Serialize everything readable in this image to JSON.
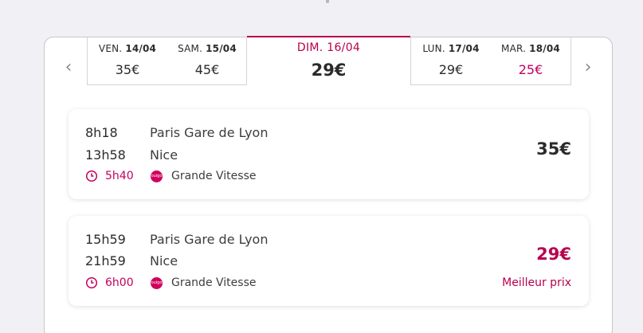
{
  "date_selector": {
    "left_dates": [
      {
        "day": "VEN.",
        "date": "14/04",
        "price": "35€",
        "promo": false
      },
      {
        "day": "SAM.",
        "date": "15/04",
        "price": "45€",
        "promo": false
      }
    ],
    "selected": {
      "day": "DIM.",
      "date": "16/04",
      "price": "29€"
    },
    "right_dates": [
      {
        "day": "LUN.",
        "date": "17/04",
        "price": "29€",
        "promo": false
      },
      {
        "day": "MAR.",
        "date": "18/04",
        "price": "25€",
        "promo": true
      }
    ],
    "prev_icon": "chevron-left-icon",
    "next_icon": "chevron-right-icon"
  },
  "trips": [
    {
      "departure_time": "8h18",
      "arrival_time": "13h58",
      "departure_station": "Paris Gare de Lyon",
      "arrival_station": "Nice",
      "duration": "5h40",
      "operator_logo": "ouigo",
      "operator": "Grande Vitesse",
      "price": "35€",
      "badge": ""
    },
    {
      "departure_time": "15h59",
      "arrival_time": "21h59",
      "departure_station": "Paris Gare de Lyon",
      "arrival_station": "Nice",
      "duration": "6h00",
      "operator_logo": "ouigo",
      "operator": "Grande Vitesse",
      "price": "29€",
      "badge": "Meilleur prix"
    }
  ],
  "colors": {
    "accent": "#b8004e",
    "promo_price": "#c4005f",
    "background": "#f1f0f4"
  }
}
